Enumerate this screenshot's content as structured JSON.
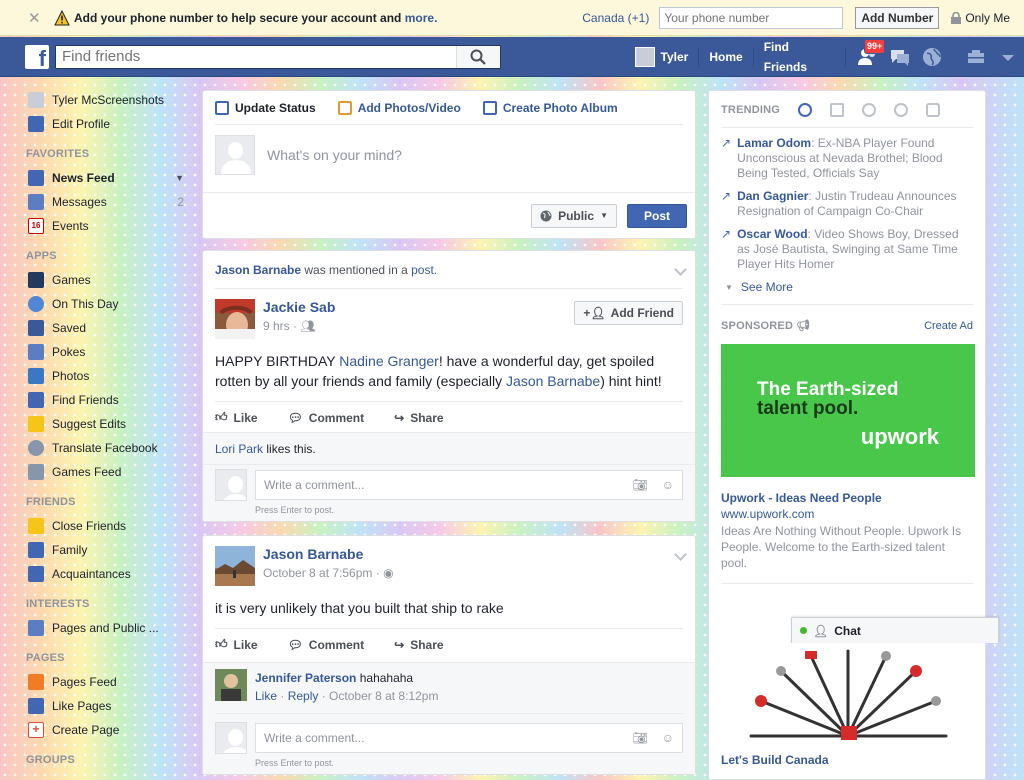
{
  "phone_bar": {
    "message": "Add your phone number to help secure your account and",
    "more_link": "more.",
    "country": "Canada (+1)",
    "phone_placeholder": "Your phone number",
    "add_button": "Add Number",
    "privacy": "Only Me"
  },
  "header": {
    "search_placeholder": "Find friends",
    "user_name": "Tyler",
    "home": "Home",
    "find_friends": "Find Friends",
    "friend_requests_badge": "99+"
  },
  "sidebar": {
    "profile_name": "Tyler McScreenshots",
    "edit_profile": "Edit Profile",
    "favorites_header": "FAVORITES",
    "favorites": [
      {
        "label": "News Feed",
        "count": ""
      },
      {
        "label": "Messages",
        "count": "2"
      },
      {
        "label": "Events",
        "count": ""
      }
    ],
    "apps_header": "APPS",
    "apps": [
      "Games",
      "On This Day",
      "Saved",
      "Pokes",
      "Photos",
      "Find Friends",
      "Suggest Edits",
      "Translate Facebook",
      "Games Feed"
    ],
    "friends_header": "FRIENDS",
    "friends": [
      "Close Friends",
      "Family",
      "Acquaintances"
    ],
    "interests_header": "INTERESTS",
    "interests": [
      "Pages and Public ..."
    ],
    "pages_header": "PAGES",
    "pages": [
      "Pages Feed",
      "Like Pages",
      "Create Page"
    ],
    "groups_header": "GROUPS"
  },
  "composer": {
    "tab_status": "Update Status",
    "tab_photos": "Add Photos/Video",
    "tab_album": "Create Photo Album",
    "placeholder": "What's on your mind?",
    "privacy": "Public",
    "post_button": "Post"
  },
  "post1": {
    "story_actor": "Jason Barnabe",
    "story_middle": " was mentioned in a ",
    "story_link": "post",
    "story_end": ".",
    "author": "Jackie Sab",
    "time": "9 hrs",
    "add_friend": "Add Friend",
    "text_1": "HAPPY BIRTHDAY ",
    "mention_1": "Nadine Granger",
    "text_2": "! have a wonderful day, get spoiled rotten by all your friends and family (especially ",
    "mention_2": "Jason Barnabe",
    "text_3": ") hint hint!",
    "like": "Like",
    "comment": "Comment",
    "share": "Share",
    "liker": "Lori Park",
    "likes_suffix": " likes this.",
    "comment_placeholder": "Write a comment...",
    "press_enter": "Press Enter to post."
  },
  "post2": {
    "author": "Jason Barnabe",
    "time": "October 8 at 7:56pm",
    "text": "it is very unlikely that you built that ship to rake",
    "like": "Like",
    "comment": "Comment",
    "share": "Share",
    "commenter": "Jennifer Paterson",
    "comment_text": "hahahaha",
    "comment_like": "Like",
    "comment_reply": "Reply",
    "comment_time": "October 8 at 8:12pm",
    "comment_placeholder": "Write a comment...",
    "press_enter": "Press Enter to post."
  },
  "trending": {
    "title": "TRENDING",
    "items": [
      {
        "name": "Lamar Odom",
        "desc": ": Ex-NBA Player Found Unconscious at Nevada Brothel; Blood Being Tested, Officials Say"
      },
      {
        "name": "Dan Gagnier",
        "desc": ": Justin Trudeau Announces Resignation of Campaign Co-Chair"
      },
      {
        "name": "Oscar Wood",
        "desc": ": Video Shows Boy, Dressed as José Bautista, Swinging at Same Time Player Hits Homer"
      }
    ],
    "see_more": "See More"
  },
  "sponsored": {
    "title": "SPONSORED",
    "create_ad": "Create Ad",
    "ad_image_line1": "The Earth-sized",
    "ad_image_line2": "talent pool.",
    "ad_logo": "upwork",
    "ad_title": "Upwork - Ideas Need People",
    "ad_url": "www.upwork.com",
    "ad_desc": "Ideas Are Nothing Without People. Upwork Is People. Welcome to the Earth-sized talent pool.",
    "ad2_title": "Let's Build Canada"
  },
  "chat": {
    "label": "Chat"
  },
  "colors": {
    "fb_blue": "#3b5998",
    "link": "#365899",
    "online": "#42b72a",
    "upwork_green": "#49c74b"
  }
}
